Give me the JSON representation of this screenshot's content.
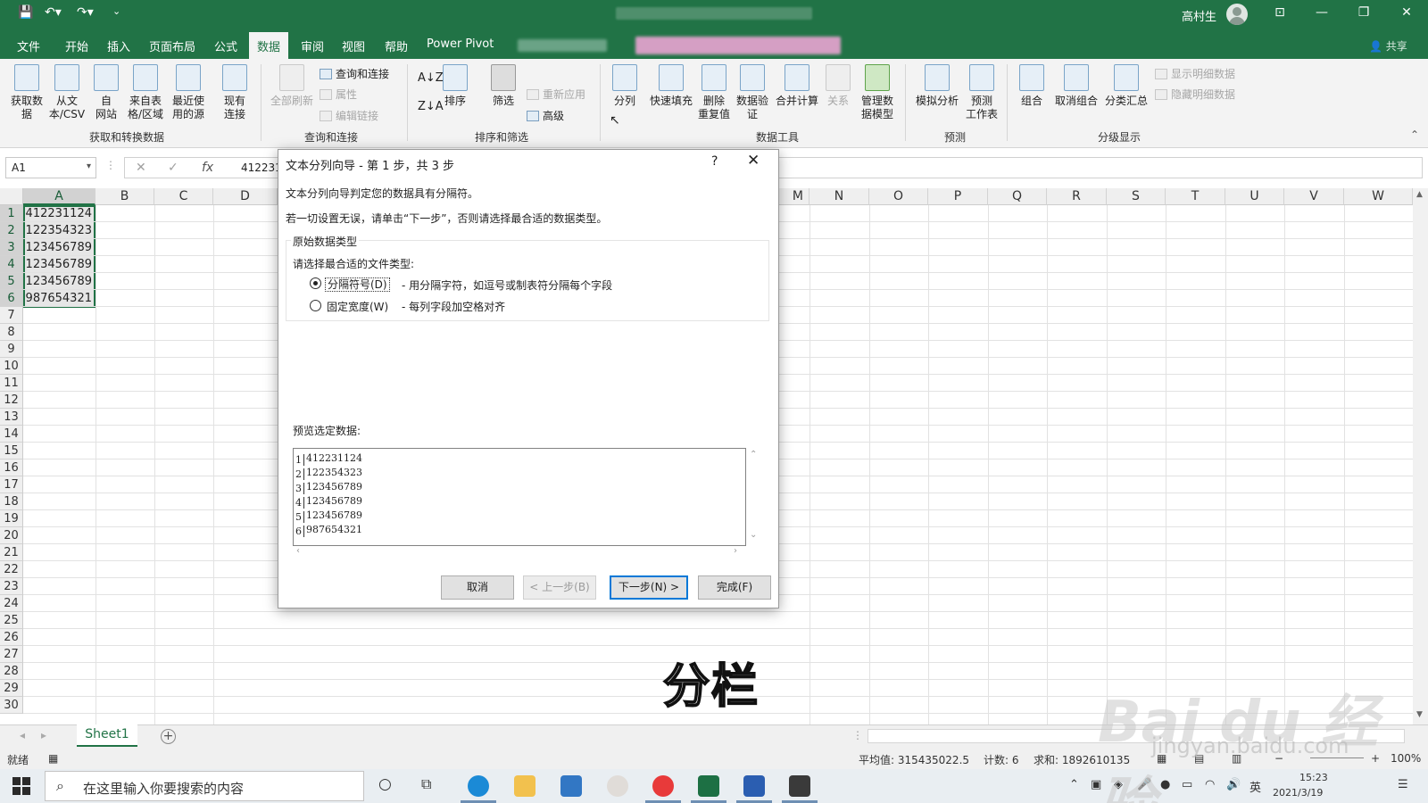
{
  "titlebar": {
    "user": "高村生"
  },
  "tabs": [
    "文件",
    "开始",
    "插入",
    "页面布局",
    "公式",
    "数据",
    "审阅",
    "视图",
    "帮助",
    "Power Pivot"
  ],
  "share": "共享",
  "ribbon": {
    "get_data": "获取数\n据",
    "from_csv": "从文\n本/CSV",
    "from_web": "自\n网站",
    "from_table": "来自表\n格/区域",
    "recent": "最近使\n用的源",
    "existing": "现有\n连接",
    "refresh_all": "全部刷新",
    "queries": "查询和连接",
    "properties": "属性",
    "edit_links": "编辑链接",
    "sort": "排序",
    "filter": "筛选",
    "reapply": "重新应用",
    "advanced": "高级",
    "split": "分列",
    "flash_fill": "快速填充",
    "remove_dup": "删除\n重复值",
    "validation": "数据验\n证",
    "consolidate": "合并计算",
    "relations": "关系",
    "data_model": "管理数\n据模型",
    "whatif": "模拟分析",
    "forecast": "预测\n工作表",
    "group": "组合",
    "ungroup": "取消组合",
    "subtotal": "分类汇总",
    "show_detail": "显示明细数据",
    "hide_detail": "隐藏明细数据",
    "groups": [
      "获取和转换数据",
      "查询和连接",
      "排序和筛选",
      "数据工具",
      "预测",
      "分级显示"
    ]
  },
  "formula": {
    "namebox": "A1",
    "value": "412231"
  },
  "columns": [
    "A",
    "B",
    "C",
    "D",
    "M",
    "N",
    "O",
    "P",
    "Q",
    "R",
    "S",
    "T",
    "U",
    "V",
    "W"
  ],
  "rows": [
    "1",
    "2",
    "3",
    "4",
    "5",
    "6",
    "7",
    "8",
    "9",
    "10",
    "11",
    "12",
    "13",
    "14",
    "15",
    "16",
    "17",
    "18",
    "19",
    "20",
    "21",
    "22",
    "23",
    "24",
    "25",
    "26",
    "27",
    "28",
    "29",
    "30"
  ],
  "cells": [
    "412231124",
    "122354323",
    "123456789",
    "123456789",
    "123456789",
    "987654321"
  ],
  "dialog": {
    "title": "文本分列向导 - 第 1 步，共 3 步",
    "help": "?",
    "line1": "文本分列向导判定您的数据具有分隔符。",
    "line2": "若一切设置无误，请单击“下一步”，否则请选择最合适的数据类型。",
    "section": "原始数据类型",
    "prompt": "请选择最合适的文件类型:",
    "opt1": "分隔符号(D)",
    "opt1_desc": "- 用分隔字符，如逗号或制表符分隔每个字段",
    "opt2": "固定宽度(W)",
    "opt2_desc": "- 每列字段加空格对齐",
    "preview_label": "预览选定数据:",
    "preview": [
      {
        "n": "1",
        "v": "412231124"
      },
      {
        "n": "2",
        "v": "122354323"
      },
      {
        "n": "3",
        "v": "123456789"
      },
      {
        "n": "4",
        "v": "123456789"
      },
      {
        "n": "5",
        "v": "123456789"
      },
      {
        "n": "6",
        "v": "987654321"
      }
    ],
    "cancel": "取消",
    "back": "< 上一步(B)",
    "next": "下一步(N) >",
    "finish": "完成(F)"
  },
  "sheet": {
    "name": "Sheet1"
  },
  "status": {
    "ready": "就绪",
    "average": "平均值: 315435022.5",
    "count": "计数: 6",
    "sum": "求和: 1892610135",
    "zoom": "100%"
  },
  "taskbar": {
    "search": "在这里输入你要搜索的内容",
    "time": "15:23",
    "date": "2021/3/19",
    "ime": "英"
  },
  "caption": "分栏",
  "watermark": "Bai du 经验",
  "watermark2": "jingyan.baidu.com"
}
